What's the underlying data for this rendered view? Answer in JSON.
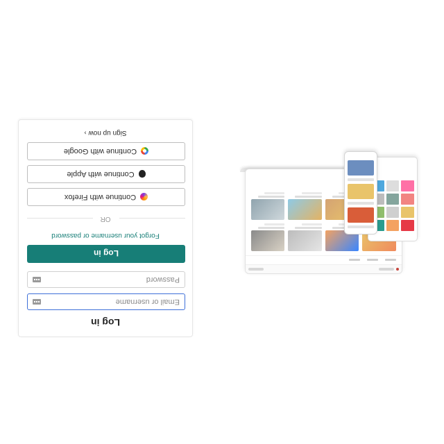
{
  "login": {
    "title": "Log in",
    "email_placeholder": "Email or username",
    "password_placeholder": "Password",
    "submit_label": "Log in",
    "forgot_label": "Forgot your username or password",
    "divider_label": "OR",
    "sso": [
      {
        "label": "Continue with Firefox",
        "icon": "firefox-icon"
      },
      {
        "label": "Continue with Apple",
        "icon": "apple-icon"
      },
      {
        "label": "Continue with Google",
        "icon": "google-icon"
      }
    ],
    "signup_label": "Sign up now",
    "signup_arrow": "›"
  },
  "colors": {
    "accent": "#177e77",
    "focus_border": "#3d6fd8"
  }
}
